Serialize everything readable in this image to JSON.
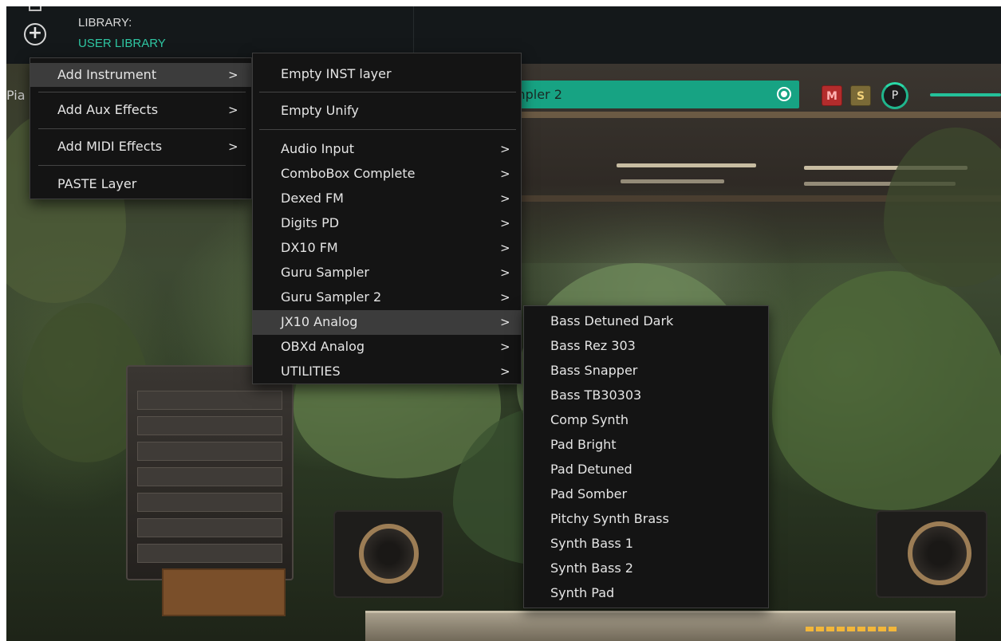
{
  "header": {
    "library_label": "LIBRARY:",
    "library_value": "USER LIBRARY"
  },
  "layer": {
    "left_label_fragment": "Pia",
    "name_fragment": "mpler 2",
    "mute_label": "M",
    "solo_label": "S",
    "pan_label": "P",
    "accent_color": "#17a383"
  },
  "main_menu": {
    "items": [
      {
        "label": "Add Instrument",
        "arrow": ">"
      },
      {
        "label": "Add Aux Effects",
        "arrow": ">"
      },
      {
        "label": "Add MIDI Effects",
        "arrow": ">"
      },
      {
        "label": "PASTE Layer"
      }
    ]
  },
  "instrument_menu": {
    "top_items": [
      "Empty INST layer",
      "Empty Unify"
    ],
    "items": [
      {
        "label": "Audio Input",
        "arrow": ">"
      },
      {
        "label": "ComboBox Complete",
        "arrow": ">"
      },
      {
        "label": "Dexed FM",
        "arrow": ">"
      },
      {
        "label": "Digits PD",
        "arrow": ">"
      },
      {
        "label": "DX10 FM",
        "arrow": ">"
      },
      {
        "label": "Guru Sampler",
        "arrow": ">"
      },
      {
        "label": "Guru Sampler 2",
        "arrow": ">"
      },
      {
        "label": "JX10 Analog",
        "arrow": ">"
      },
      {
        "label": "OBXd Analog",
        "arrow": ">"
      },
      {
        "label": "UTILITIES",
        "arrow": ">"
      }
    ]
  },
  "jx10_menu": {
    "items": [
      "Bass Detuned Dark",
      "Bass Rez 303",
      "Bass Snapper",
      "Bass TB30303",
      "Comp Synth",
      "Pad Bright",
      "Pad Detuned",
      "Pad Somber",
      "Pitchy Synth Brass",
      "Synth Bass 1",
      "Synth Bass 2",
      "Synth Pad"
    ]
  },
  "icons": [
    "add-circle-icon",
    "target-icon",
    "chevron-right-icon",
    "pan-knob-icon"
  ]
}
